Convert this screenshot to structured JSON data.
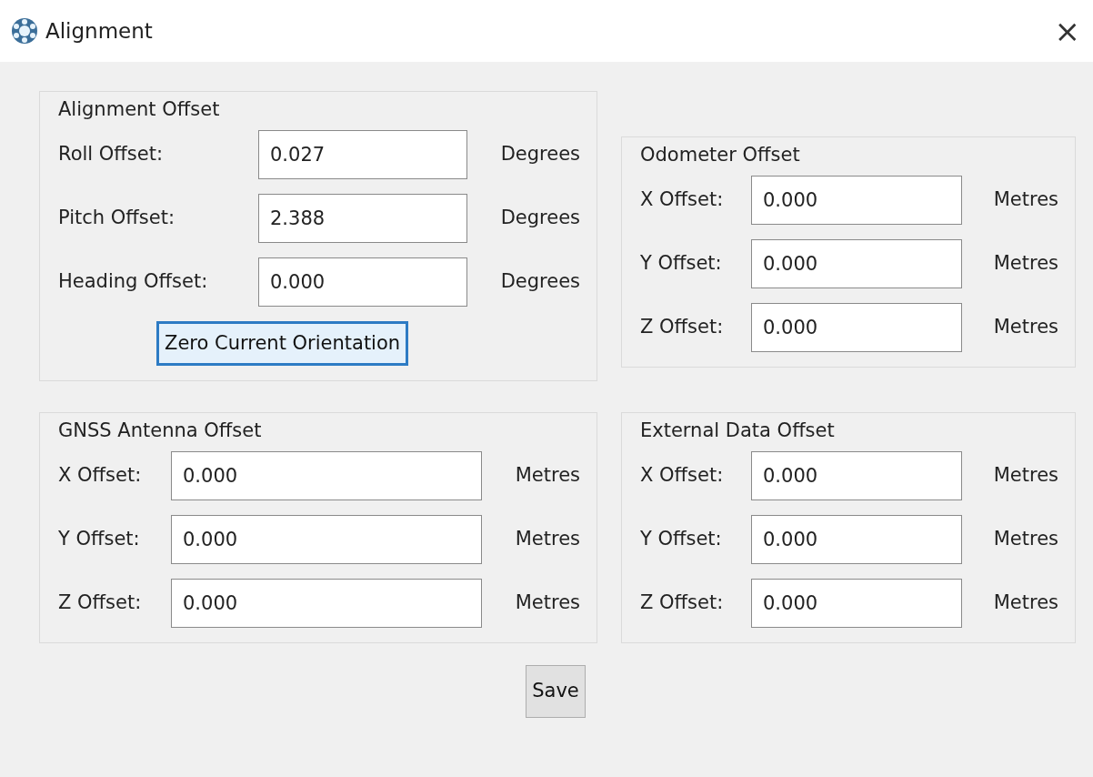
{
  "window": {
    "title": "Alignment",
    "close": "×"
  },
  "groups": [
    {
      "title": "Alignment Offset",
      "fields": [
        {
          "label": "Roll Offset:",
          "value": "0.027",
          "unit": "Degrees"
        },
        {
          "label": "Pitch Offset:",
          "value": "2.388",
          "unit": "Degrees"
        },
        {
          "label": "Heading Offset:",
          "value": "0.000",
          "unit": "Degrees"
        }
      ],
      "button": {
        "label": "Zero Current Orientation",
        "focused": true
      }
    },
    {
      "title": "Odometer Offset",
      "fields": [
        {
          "label": "X Offset:",
          "value": "0.000",
          "unit": "Metres"
        },
        {
          "label": "Y Offset:",
          "value": "0.000",
          "unit": "Metres"
        },
        {
          "label": "Z Offset:",
          "value": "0.000",
          "unit": "Metres"
        }
      ]
    },
    {
      "title": "GNSS Antenna Offset",
      "fields": [
        {
          "label": "X Offset:",
          "value": "0.000",
          "unit": "Metres"
        },
        {
          "label": "Y Offset:",
          "value": "0.000",
          "unit": "Metres"
        },
        {
          "label": "Z Offset:",
          "value": "0.000",
          "unit": "Metres"
        }
      ]
    },
    {
      "title": "External Data Offset",
      "fields": [
        {
          "label": "X Offset:",
          "value": "0.000",
          "unit": "Metres"
        },
        {
          "label": "Y Offset:",
          "value": "0.000",
          "unit": "Metres"
        },
        {
          "label": "Z Offset:",
          "value": "0.000",
          "unit": "Metres"
        }
      ]
    }
  ],
  "save_button": {
    "label": "Save",
    "focused": false
  }
}
